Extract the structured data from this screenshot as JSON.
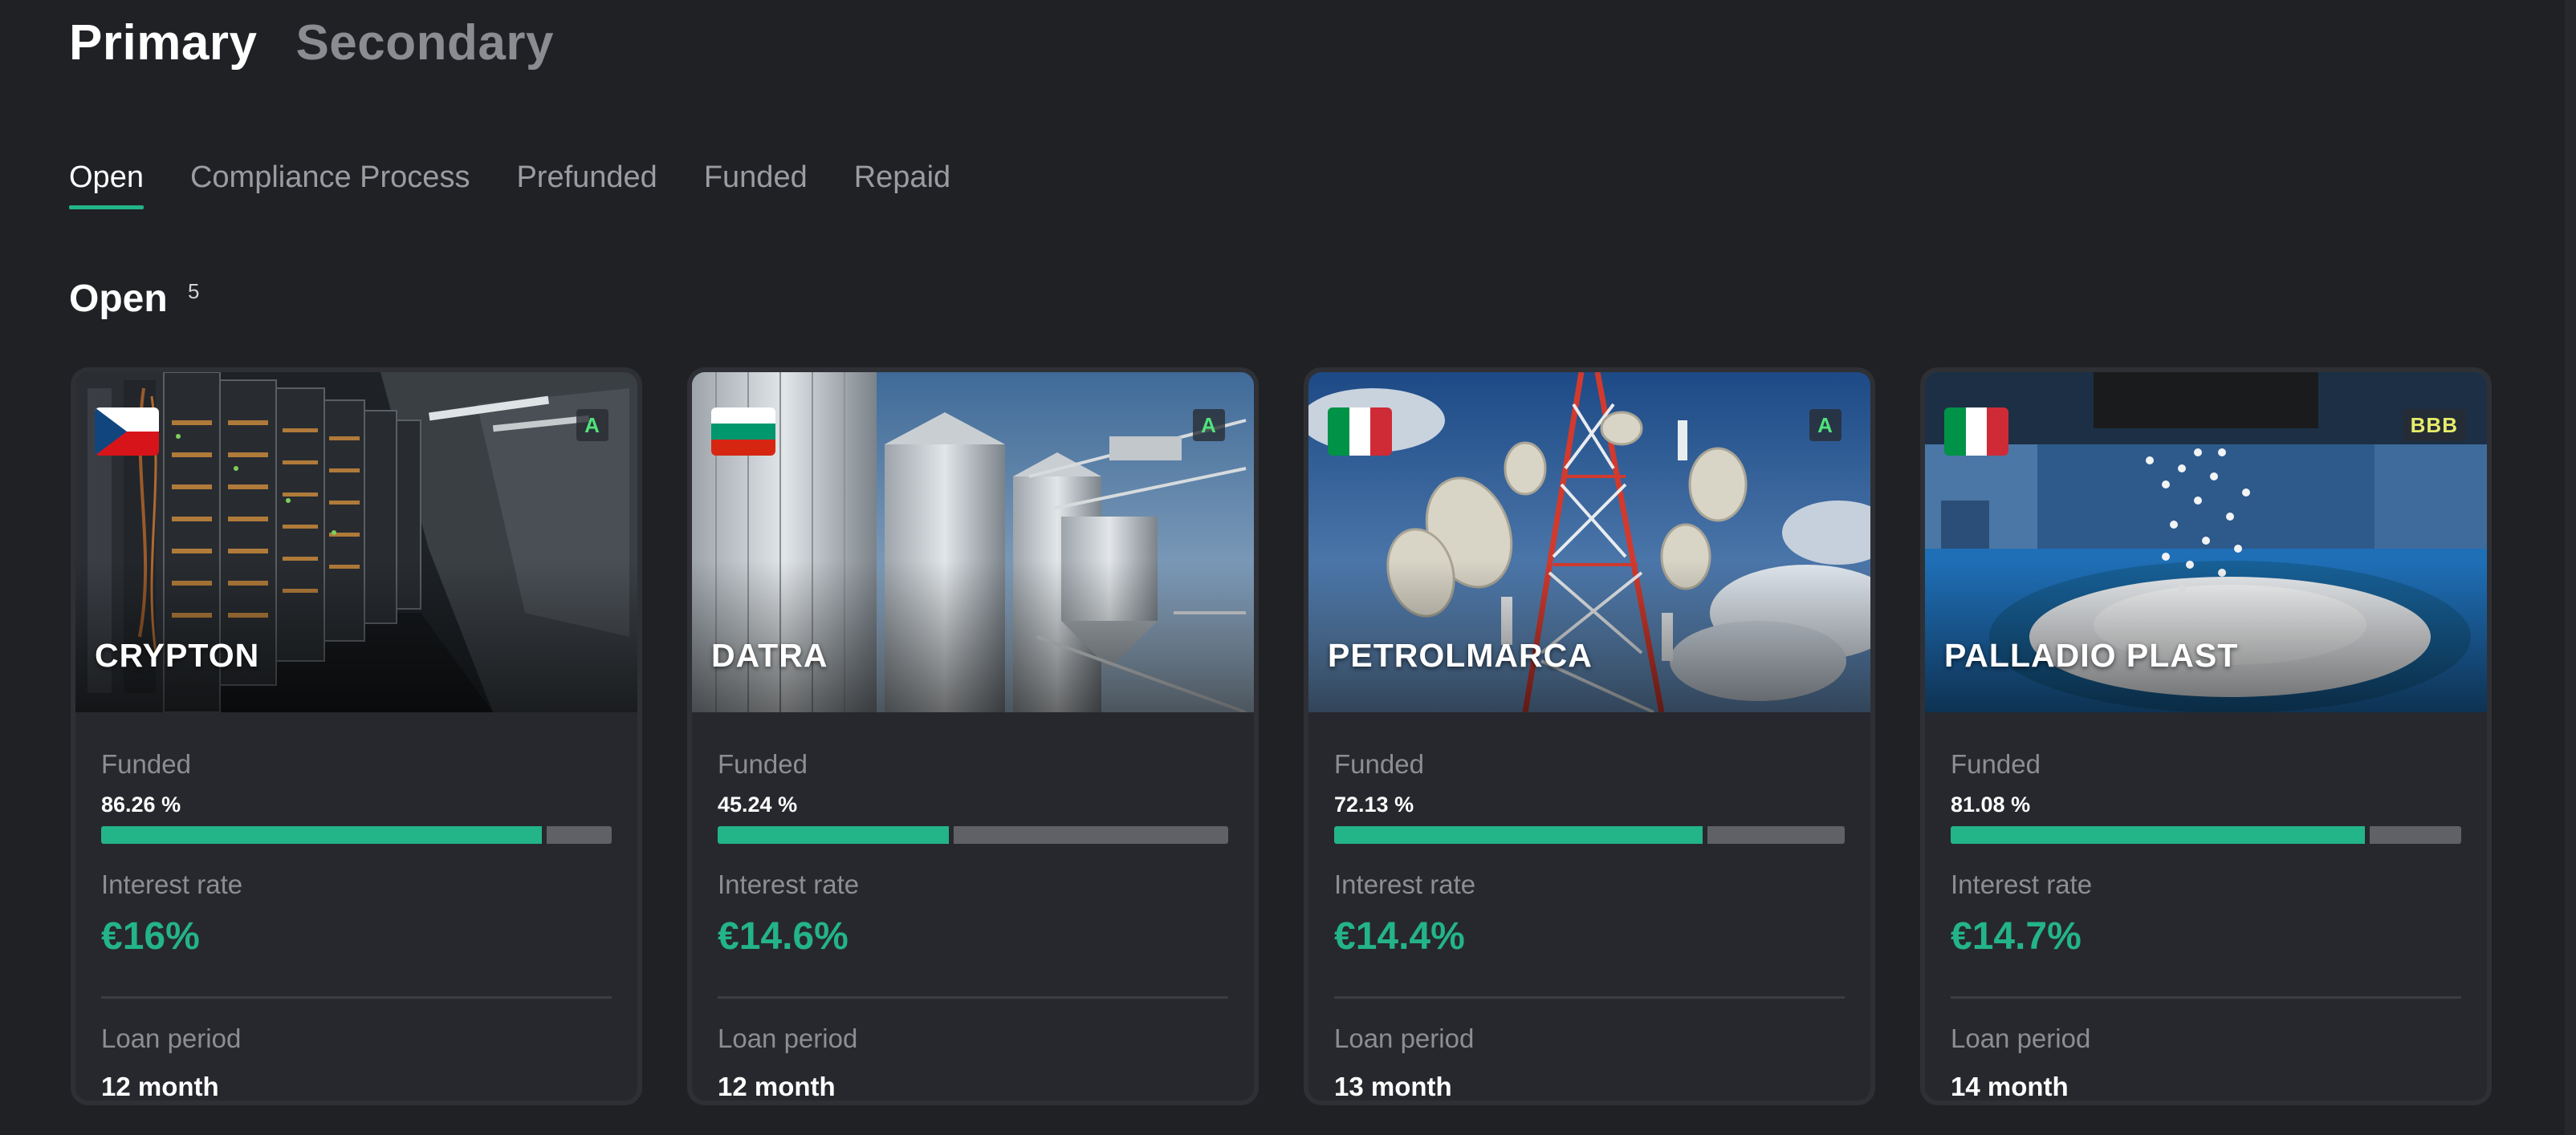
{
  "market_tabs": [
    {
      "label": "Primary",
      "active": true
    },
    {
      "label": "Secondary",
      "active": false
    }
  ],
  "status_tabs": [
    {
      "label": "Open",
      "active": true
    },
    {
      "label": "Compliance Process",
      "active": false
    },
    {
      "label": "Prefunded",
      "active": false
    },
    {
      "label": "Funded",
      "active": false
    },
    {
      "label": "Repaid",
      "active": false
    }
  ],
  "section": {
    "title": "Open",
    "count": "5"
  },
  "labels": {
    "funded": "Funded",
    "interest_rate": "Interest rate",
    "loan_period": "Loan period"
  },
  "colors": {
    "accent": "#23b488",
    "background": "#1f2125",
    "card": "#27282d",
    "rating_a": "#4fe37a",
    "rating_bbb": "#e6ec6a"
  },
  "cards": [
    {
      "name": "CRYPTON",
      "flag_icon": "czech-flag-icon",
      "rating": "A",
      "funded_pct": "86.26 %",
      "funded_fraction": 0.8626,
      "interest_rate": "€16%",
      "loan_period": "12 month",
      "image": "server-racks"
    },
    {
      "name": "DATRA",
      "flag_icon": "bulgaria-flag-icon",
      "rating": "A",
      "funded_pct": "45.24 %",
      "funded_fraction": 0.4524,
      "interest_rate": "€14.6%",
      "loan_period": "12 month",
      "image": "grain-silos"
    },
    {
      "name": "PETROLMARCA",
      "flag_icon": "italy-flag-icon",
      "rating": "A",
      "funded_pct": "72.13 %",
      "funded_fraction": 0.7213,
      "interest_rate": "€14.4%",
      "loan_period": "13 month",
      "image": "telecom-tower"
    },
    {
      "name": "PALLADIO PLAST",
      "flag_icon": "italy-flag-icon",
      "rating": "BBB",
      "funded_pct": "81.08 %",
      "funded_fraction": 0.8108,
      "interest_rate": "€14.7%",
      "loan_period": "14 month",
      "image": "plastic-pellets"
    }
  ]
}
